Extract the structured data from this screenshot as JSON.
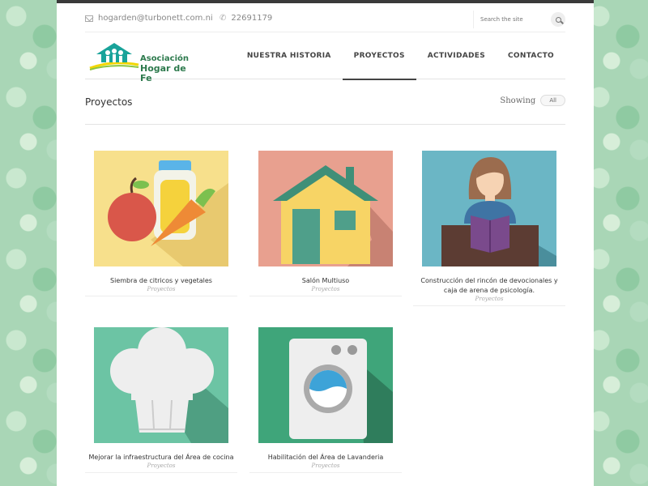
{
  "topbar": {
    "email": "hogarden@turbonett.com.ni",
    "phone": "22691179",
    "search_placeholder": "Search the site"
  },
  "logo": {
    "line1": "Asociación",
    "line2": "Hogar de Fe"
  },
  "nav": {
    "items": [
      {
        "label": "NUESTRA HISTORIA",
        "active": false
      },
      {
        "label": "PROYECTOS",
        "active": true
      },
      {
        "label": "ACTIVIDADES",
        "active": false
      },
      {
        "label": "CONTACTO",
        "active": false
      }
    ]
  },
  "main": {
    "title": "Proyectos",
    "filter_label": "Showing",
    "filter_value": "All"
  },
  "projects": [
    {
      "title": "Siembra de citricos y vegetales",
      "category": "Proyectos",
      "icon": "vegetables-icon",
      "bg": "#f7e08c"
    },
    {
      "title": "Salón Multiuso",
      "category": "Proyectos",
      "icon": "house-icon",
      "bg": "#e8a08f"
    },
    {
      "title": "Construcción del rincón de devocionales y caja de arena de psicología.",
      "category": "Proyectos",
      "icon": "reader-icon",
      "bg": "#6bb6c5"
    },
    {
      "title": "Mejorar la infraestructura del Área de cocina",
      "category": "Proyectos",
      "icon": "chef-hat-icon",
      "bg": "#6cc4a4"
    },
    {
      "title": "Habilitación del Área de Lavanderia",
      "category": "Proyectos",
      "icon": "washing-machine-icon",
      "bg": "#3fa57a"
    }
  ]
}
